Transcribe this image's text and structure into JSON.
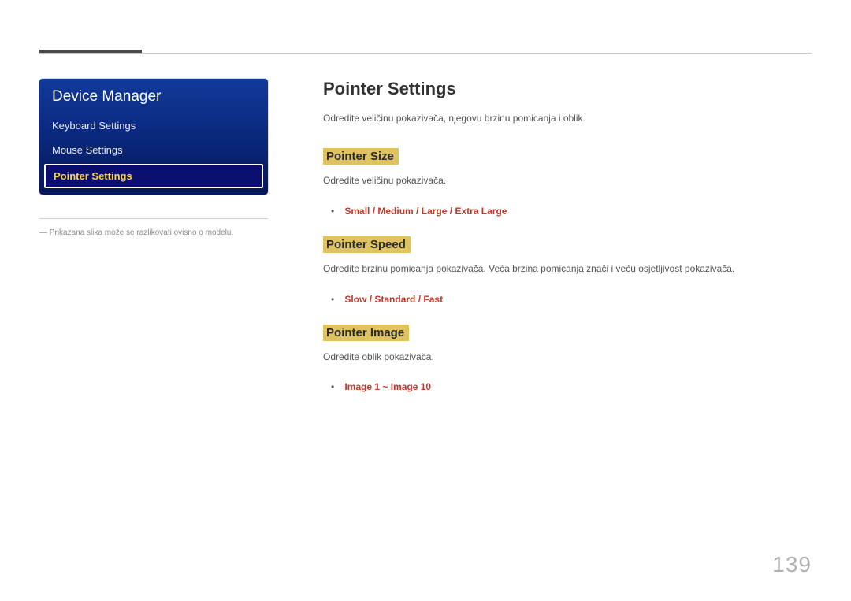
{
  "sidebar": {
    "title": "Device Manager",
    "items": [
      {
        "label": "Keyboard Settings",
        "selected": false
      },
      {
        "label": "Mouse Settings",
        "selected": false
      },
      {
        "label": "Pointer Settings",
        "selected": true
      }
    ],
    "note_prefix": "―",
    "note": "Prikazana slika može se razlikovati ovisno o modelu."
  },
  "main": {
    "title": "Pointer Settings",
    "intro": "Odredite veličinu pokazivača, njegovu brzinu pomicanja i oblik.",
    "sections": [
      {
        "heading": "Pointer Size",
        "desc": "Odredite veličinu pokazivača.",
        "options": [
          "Small",
          "Medium",
          "Large",
          "Extra Large"
        ],
        "sep": " / "
      },
      {
        "heading": "Pointer Speed",
        "desc": "Odredite brzinu pomicanja pokazivača. Veća brzina pomicanja znači i veću osjetljivost pokazivača.",
        "options": [
          "Slow",
          "Standard",
          "Fast"
        ],
        "sep": " / "
      },
      {
        "heading": "Pointer Image",
        "desc": "Odredite oblik pokazivača.",
        "options": [
          "Image 1",
          "Image 10"
        ],
        "sep": " ~ "
      }
    ]
  },
  "page_number": "139"
}
